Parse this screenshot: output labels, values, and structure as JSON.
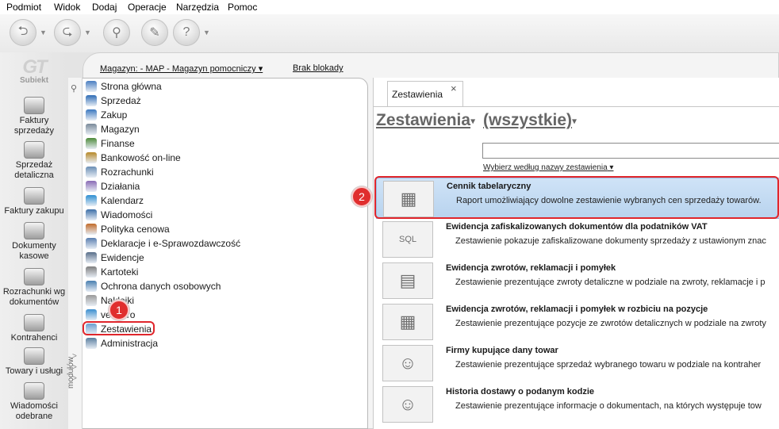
{
  "menu": [
    "Podmiot",
    "Widok",
    "Dodaj",
    "Operacje",
    "Narzędzia",
    "Pomoc"
  ],
  "logo": {
    "big": "GT",
    "small": "Subiekt"
  },
  "left_bar": [
    {
      "label": "Faktury sprzedaży",
      "icon": "invoice-sales-icon"
    },
    {
      "label": "Sprzedaż detaliczna",
      "icon": "retail-sale-icon"
    },
    {
      "label": "Faktury zakupu",
      "icon": "purchase-invoice-icon"
    },
    {
      "label": "Dokumenty kasowe",
      "icon": "cash-documents-icon"
    },
    {
      "label": "Rozrachunki wg dokumentów",
      "icon": "settlements-icon"
    },
    {
      "label": "Kontrahenci",
      "icon": "contractors-icon"
    },
    {
      "label": "Towary i usługi",
      "icon": "goods-icon"
    },
    {
      "label": "Wiadomości odebrane",
      "icon": "messages-icon"
    }
  ],
  "top_links": {
    "warehouse": "Magazyn: - MAP - Magazyn pomocniczy",
    "block": "Brak blokady"
  },
  "nav": [
    {
      "label": "Strona główna",
      "color": "#4b7fc2"
    },
    {
      "label": "Sprzedaż",
      "color": "#2f6cb5"
    },
    {
      "label": "Zakup",
      "color": "#3b78c0"
    },
    {
      "label": "Magazyn",
      "color": "#7a8a9a"
    },
    {
      "label": "Finanse",
      "color": "#4d8a3a"
    },
    {
      "label": "Bankowość on-line",
      "color": "#b88a2a"
    },
    {
      "label": "Rozrachunki",
      "color": "#6b8fb5"
    },
    {
      "label": "Działania",
      "color": "#8a6bb5"
    },
    {
      "label": "Kalendarz",
      "color": "#2e8fd2"
    },
    {
      "label": "Wiadomości",
      "color": "#3d6fa8"
    },
    {
      "label": "Polityka cenowa",
      "color": "#c26b2a"
    },
    {
      "label": "Deklaracje i e-Sprawozdawczość",
      "color": "#5a7fb0"
    },
    {
      "label": "Ewidencje",
      "color": "#5a6f8a"
    },
    {
      "label": "Kartoteki",
      "color": "#7f7f7f"
    },
    {
      "label": "Ochrona danych osobowych",
      "color": "#4a7fb0"
    },
    {
      "label": "Naklejki",
      "color": "#9a9a9a"
    },
    {
      "label": "vendero",
      "color": "#3b8fd0"
    },
    {
      "label": "Zestawienia",
      "color": "#6a9fd0"
    },
    {
      "label": "Administracja",
      "color": "#5a7fa0"
    }
  ],
  "nav_vertical_label": "modułów",
  "badges": {
    "one": "1",
    "two": "2"
  },
  "tab": {
    "label": "Zestawienia",
    "close": "×"
  },
  "heading": {
    "left": "Zestawienia",
    "right": "(wszystkie)"
  },
  "search": {
    "value": "",
    "hint": "Wybierz według nazwy zestawienia"
  },
  "reports": [
    {
      "title": "Cennik tabelaryczny",
      "desc": "Raport umożliwiający dowolne zestawienie wybranych cen sprzedaży towarów.",
      "selected": true,
      "icon": "boxes-icon"
    },
    {
      "title": "Ewidencja zafiskalizowanych dokumentów dla podatników VAT",
      "desc": "Zestawienie pokazuje zafiskalizowane dokumenty sprzedaży z ustawionym znac",
      "selected": false,
      "icon": "sql-icon"
    },
    {
      "title": "Ewidencja zwrotów, reklamacji i pomyłek",
      "desc": "Zestawienie prezentujące zwroty detaliczne w podziale na zwroty, reklamacje i p",
      "selected": false,
      "icon": "stack-icon"
    },
    {
      "title": "Ewidencja zwrotów, reklamacji i pomyłek w rozbiciu na pozycje",
      "desc": "Zestawienie prezentujące pozycje ze zwrotów detalicznych w podziale na zwroty",
      "selected": false,
      "icon": "boxes-icon"
    },
    {
      "title": "Firmy kupujące dany towar",
      "desc": "Zestawienie prezentujące sprzedaż wybranego towaru w podziale na kontraher",
      "selected": false,
      "icon": "person-icon"
    },
    {
      "title": "Historia dostawy o podanym kodzie",
      "desc": "Zestawienie prezentujące informacje o dokumentach, na których występuje tow",
      "selected": false,
      "icon": "person-icon"
    }
  ]
}
